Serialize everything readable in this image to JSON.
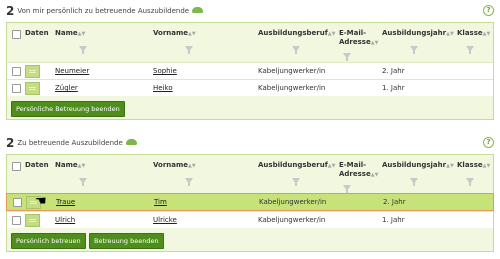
{
  "section1": {
    "count": "2",
    "title": "Von mir persönlich zu betreuende Auszubildende",
    "help": "?",
    "columns": [
      "Daten",
      "Name",
      "Vorname",
      "Ausbildungsberuf",
      "E-Mail-Adresse",
      "Ausbildungsjahr",
      "Klasse"
    ],
    "rows": [
      {
        "name": "Neumeier",
        "vorname": "Sophie",
        "beruf": "Kabeljungwerker/in",
        "jahr": "2. Jahr"
      },
      {
        "name": "Zügler",
        "vorname": "Heiko",
        "beruf": "Kabeljungwerker/in",
        "jahr": "1. Jahr"
      }
    ],
    "button": "Persönliche Betreuung beenden"
  },
  "section2": {
    "count": "2",
    "title": "Zu betreuende Auszubildende",
    "help": "?",
    "columns": [
      "Daten",
      "Name",
      "Vorname",
      "Ausbildungsberuf",
      "E-Mail-Adresse",
      "Ausbildungsjahr",
      "Klasse"
    ],
    "rows": [
      {
        "name": "Traue",
        "vorname": "Tim",
        "beruf": "Kabeljungwerker/in",
        "jahr": "2. Jahr"
      },
      {
        "name": "Ulrich",
        "vorname": "Ulricke",
        "beruf": "Kabeljungwerker/in",
        "jahr": "1. Jahr"
      }
    ],
    "button1": "Persönlich betreuen",
    "button2": "Betreuung beenden"
  },
  "colors": {
    "accent": "#4f8d1d",
    "highlight": "#c8e27a",
    "header_bg": "#f2f8df"
  }
}
